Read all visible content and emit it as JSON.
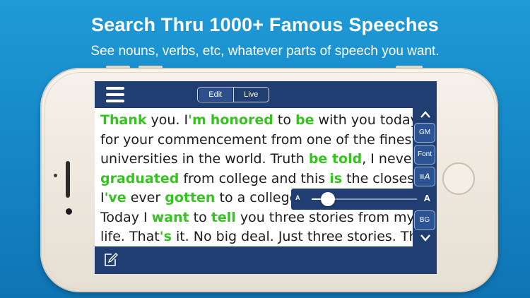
{
  "headline": "Search Thru 1000+ Famous Speeches",
  "subheadline": "See nouns, verbs, etc, whatever parts of speech you want.",
  "app": {
    "segments": [
      "Edit",
      "Live"
    ],
    "selected_segment": "Edit",
    "side_buttons": [
      "GM",
      "Font",
      "≡A",
      "BG"
    ],
    "font_slider": {
      "small_label": "A",
      "large_label": "A",
      "level": 0.12
    },
    "speech_lines": [
      [
        [
          "Thank",
          true
        ],
        [
          " you. I",
          false
        ],
        [
          "'m",
          true
        ],
        [
          " ",
          false
        ],
        [
          "honored",
          true
        ],
        [
          " to ",
          false
        ],
        [
          "be",
          true
        ],
        [
          " with you today",
          false
        ]
      ],
      [
        [
          "for your commencement from one of the finest",
          false
        ]
      ],
      [
        [
          "universities in the world. Truth ",
          false
        ],
        [
          "be told",
          true
        ],
        [
          ", I never",
          false
        ]
      ],
      [
        [
          "graduated",
          true
        ],
        [
          " from college and this ",
          false
        ],
        [
          "is",
          true
        ],
        [
          " the closest",
          false
        ]
      ],
      [
        [
          "I",
          false
        ],
        [
          "'ve",
          true
        ],
        [
          " ever ",
          false
        ],
        [
          "gotten",
          true
        ],
        [
          " to a college graduation.",
          false
        ]
      ],
      [
        [
          "Today I ",
          false
        ],
        [
          "want",
          true
        ],
        [
          " to ",
          false
        ],
        [
          "tell",
          true
        ],
        [
          " you three stories from my",
          false
        ]
      ],
      [
        [
          "life. That",
          false
        ],
        [
          "'s",
          true
        ],
        [
          " it. No big deal. Just three stories. The",
          false
        ]
      ]
    ]
  },
  "colors": {
    "background": "#1689c9",
    "app_bar": "#213e72",
    "highlight": "#35c41f",
    "text": "#1c1c1c"
  }
}
